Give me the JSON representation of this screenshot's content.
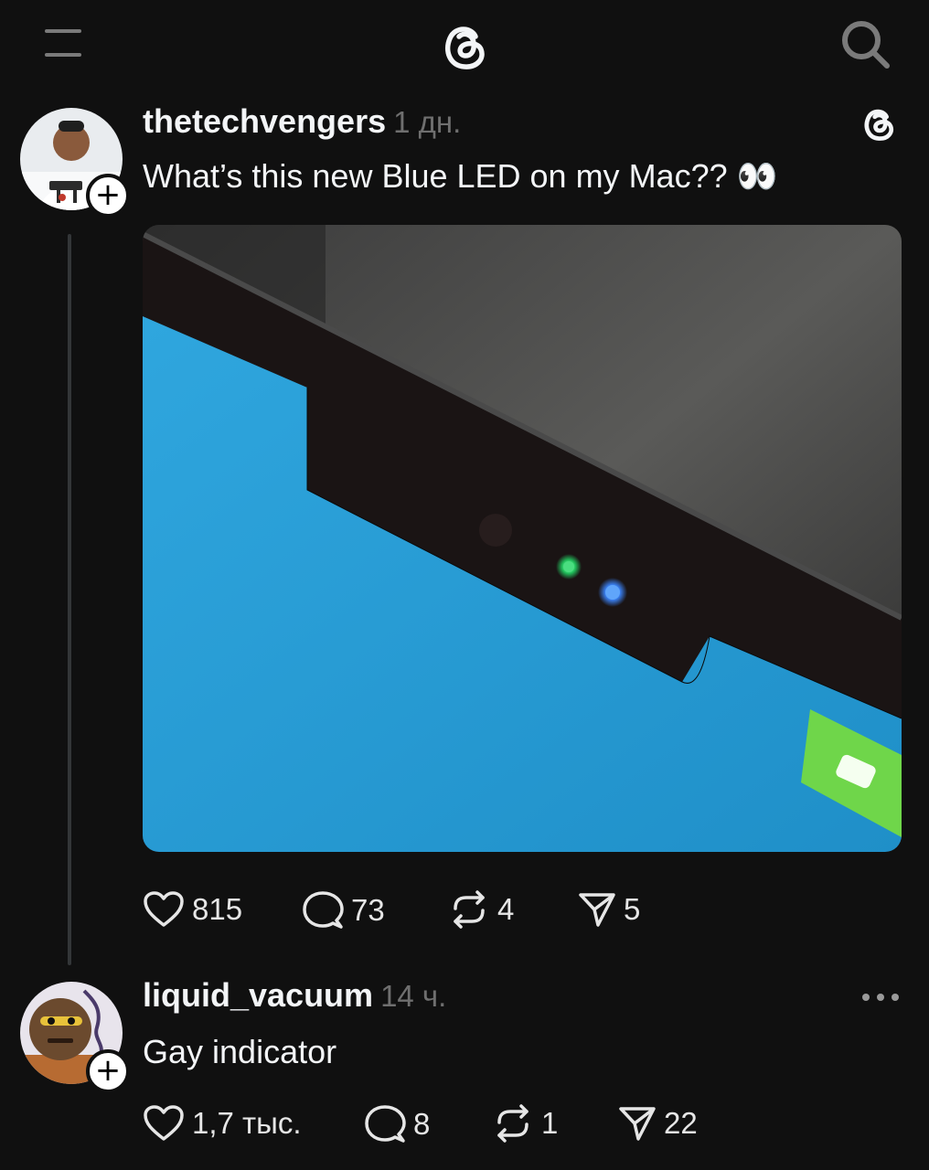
{
  "topbar": {
    "menu_icon": "menu-icon",
    "logo_icon": "threads-logo-icon",
    "search_icon": "search-icon"
  },
  "post": {
    "username": "thetechvengers",
    "time": "1 дн.",
    "text": "What’s this new Blue LED on my Mac?? 👀",
    "source_icon": "threads-logo-icon",
    "image_description_icon": "mac-notch-photo",
    "likes": "815",
    "replies": "73",
    "reposts": "4",
    "shares": "5"
  },
  "reply": {
    "username": "liquid_vacuum",
    "time": "14 ч.",
    "text": "Gay indicator",
    "likes": "1,7 тыс.",
    "replies": "8",
    "reposts": "1",
    "shares": "22"
  },
  "colors": {
    "background": "#101010",
    "text": "#f3f5f7",
    "muted": "#6f6f6f",
    "led_green": "#22c55e",
    "led_blue": "#3b82f6",
    "screen_blue": "#2a9fd6"
  }
}
